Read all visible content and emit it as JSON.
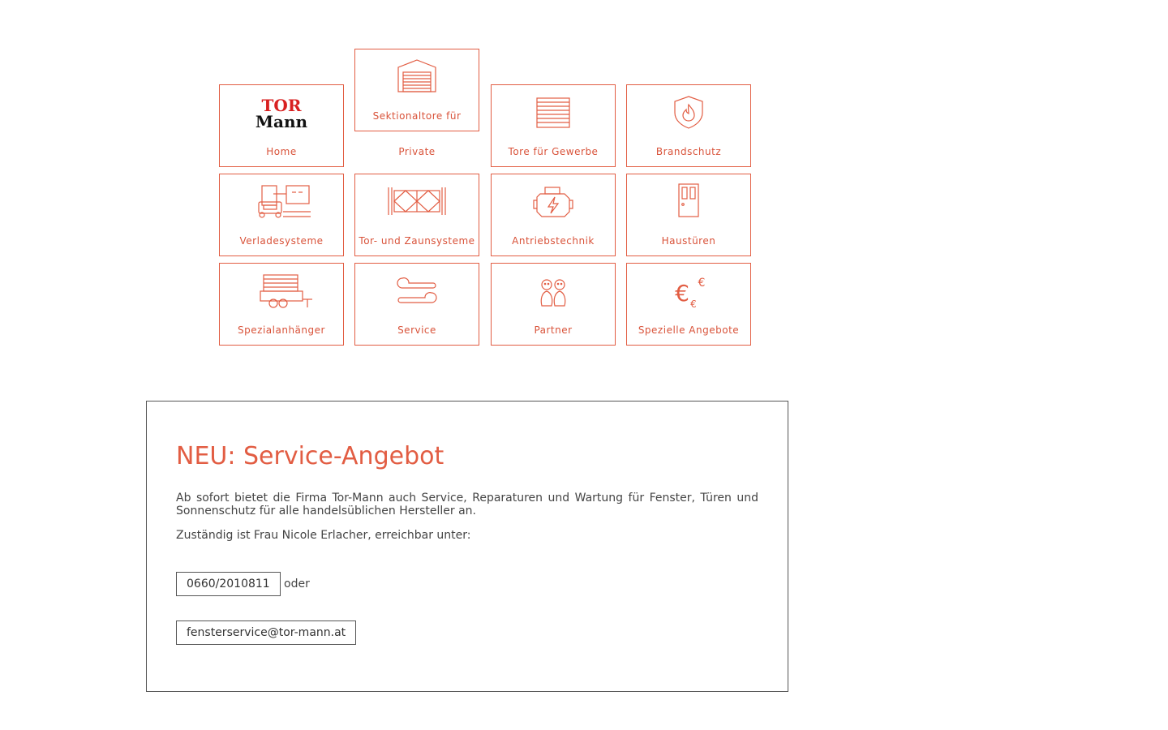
{
  "nav": {
    "home": "Home",
    "sektionaltore_top": "Sektionaltore für",
    "sektionaltore_bottom": "Private",
    "tore_gewerbe": "Tore für Gewerbe",
    "brandschutz": "Brandschutz",
    "verladesysteme": "Verladesysteme",
    "tor_zaun": "Tor- und Zaunsysteme",
    "antrieb": "Antriebstechnik",
    "haustueren": "Haustüren",
    "spezialanhaenger": "Spezialanhänger",
    "service": "Service",
    "partner": "Partner",
    "angebote": "Spezielle Angebote"
  },
  "logo": {
    "line1": "TOR",
    "line2": "Mann"
  },
  "panel": {
    "title": "NEU: Service-Angebot",
    "paragraph1": "Ab sofort bietet die Firma Tor-Mann auch Service, Reparaturen und Wartung für Fenster, Türen und Sonnenschutz für alle handelsüblichen Hersteller an.",
    "paragraph2": "Zuständig ist Frau Nicole Erlacher, erreichbar unter:",
    "phone": "0660/2010811",
    "or": "oder",
    "email": "fensterservice@tor-mann.at"
  },
  "colors": {
    "accent": "#e25d43",
    "border": "#555555",
    "text": "#444444"
  },
  "icons": {
    "home": "tor-mann-logo",
    "sektionaltore": "garage-icon",
    "tore_gewerbe": "shutter-icon",
    "brandschutz": "fire-shield-icon",
    "verladesysteme": "truck-dock-icon",
    "tor_zaun": "fence-gate-icon",
    "antrieb": "motor-icon",
    "haustueren": "door-icon",
    "spezialanhaenger": "trailer-icon",
    "service": "wrench-icon",
    "partner": "partner-icon",
    "angebote": "euro-icon"
  }
}
